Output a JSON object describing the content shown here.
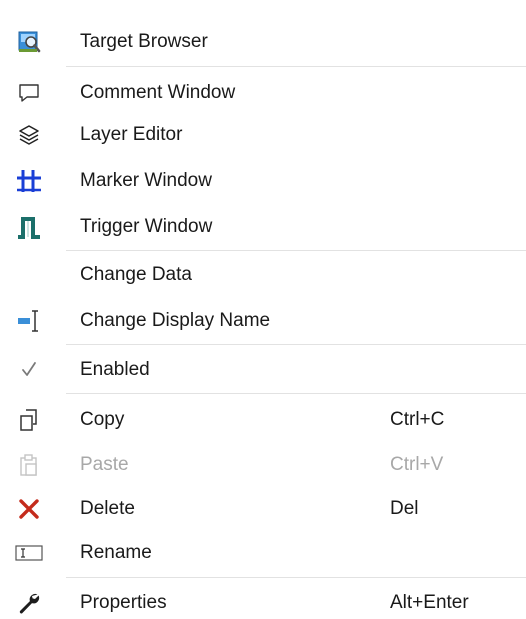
{
  "menu": {
    "items": [
      {
        "label": "Target Browser",
        "icon": "target-browser-icon"
      },
      {
        "label": "Comment Window",
        "icon": "comment-icon"
      },
      {
        "label": "Layer Editor",
        "icon": "layers-icon"
      },
      {
        "label": "Marker Window",
        "icon": "marker-grid-icon"
      },
      {
        "label": "Trigger Window",
        "icon": "trigger-icon"
      },
      {
        "label": "Change Data",
        "icon": ""
      },
      {
        "label": "Change Display Name",
        "icon": "rename-cursor-icon"
      },
      {
        "label": "Enabled",
        "icon": "checkmark-icon",
        "checked": true
      },
      {
        "label": "Copy",
        "shortcut": "Ctrl+C",
        "icon": "copy-icon"
      },
      {
        "label": "Paste",
        "shortcut": "Ctrl+V",
        "icon": "paste-icon",
        "disabled": true
      },
      {
        "label": "Delete",
        "shortcut": "Del",
        "icon": "delete-x-icon"
      },
      {
        "label": "Rename",
        "icon": "rename-field-icon"
      },
      {
        "label": "Properties",
        "shortcut": "Alt+Enter",
        "icon": "wrench-icon"
      }
    ]
  },
  "colors": {
    "delete_red": "#c42b1c",
    "marker_blue": "#1a3fd6",
    "trigger_teal": "#1b6f6a",
    "disabled_text": "#a8a8a8",
    "separator": "#e2e2e2"
  }
}
